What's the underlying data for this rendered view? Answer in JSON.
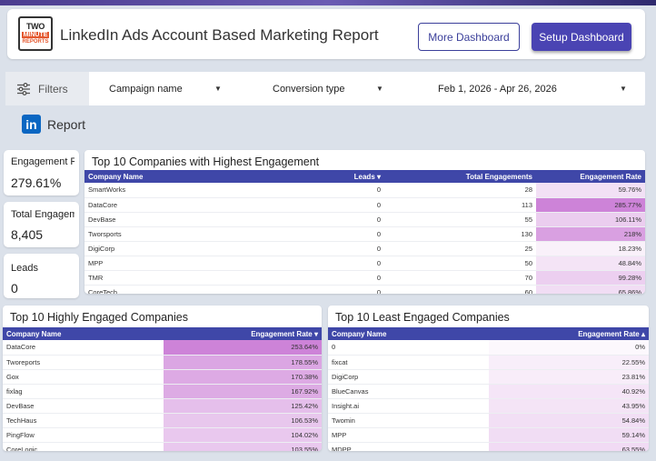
{
  "header": {
    "logo": {
      "line1": "TWO",
      "line2": "MINUTE",
      "line3": "REPORTS"
    },
    "title": "LinkedIn Ads Account Based Marketing Report",
    "more_dashboard": "More Dashboard",
    "setup_dashboard": "Setup Dashboard"
  },
  "filters": {
    "label": "Filters",
    "campaign": "Campaign name",
    "conversion": "Conversion type",
    "date_range": "Feb 1, 2026 - Apr 26, 2026"
  },
  "section": {
    "icon_text": "in",
    "label": "Report"
  },
  "kpis": [
    {
      "label": "Engagement Rate",
      "value": "279.61%"
    },
    {
      "label": "Total Engagements",
      "value": "8,405"
    },
    {
      "label": "Leads",
      "value": "0"
    }
  ],
  "top_engagement": {
    "title": "Top 10 Companies with Highest Engagement",
    "columns": [
      "Company Name",
      "Leads ▾",
      "Total Engagements",
      "Engagement Rate"
    ],
    "rows": [
      {
        "company": "SmartWorks",
        "leads": "0",
        "engagements": "28",
        "rate": "59.76%",
        "rate_value": 59.76
      },
      {
        "company": "DataCore",
        "leads": "0",
        "engagements": "113",
        "rate": "285.77%",
        "rate_value": 285.77
      },
      {
        "company": "DevBase",
        "leads": "0",
        "engagements": "55",
        "rate": "106.11%",
        "rate_value": 106.11
      },
      {
        "company": "Tworsports",
        "leads": "0",
        "engagements": "130",
        "rate": "218%",
        "rate_value": 218
      },
      {
        "company": "DigiCorp",
        "leads": "0",
        "engagements": "25",
        "rate": "18.23%",
        "rate_value": 18.23
      },
      {
        "company": "MPP",
        "leads": "0",
        "engagements": "50",
        "rate": "48.84%",
        "rate_value": 48.84
      },
      {
        "company": "TMR",
        "leads": "0",
        "engagements": "70",
        "rate": "99.28%",
        "rate_value": 99.28
      },
      {
        "company": "CoreTech",
        "leads": "0",
        "engagements": "60",
        "rate": "65.86%",
        "rate_value": 65.86
      }
    ]
  },
  "highly_engaged": {
    "title": "Top 10 Highly Engaged Companies",
    "columns": [
      "Company Name",
      "Engagement Rate ▾"
    ],
    "rows": [
      {
        "company": "DataCore",
        "rate": "253.64%",
        "rate_value": 253.64
      },
      {
        "company": "Tworeports",
        "rate": "178.55%",
        "rate_value": 178.55
      },
      {
        "company": "Gox",
        "rate": "170.38%",
        "rate_value": 170.38
      },
      {
        "company": "fixlag",
        "rate": "167.92%",
        "rate_value": 167.92
      },
      {
        "company": "DevBase",
        "rate": "125.42%",
        "rate_value": 125.42
      },
      {
        "company": "TechHaus",
        "rate": "106.53%",
        "rate_value": 106.53
      },
      {
        "company": "PingFlow",
        "rate": "104.02%",
        "rate_value": 104.02
      },
      {
        "company": "CoreLogic",
        "rate": "103.55%",
        "rate_value": 103.55
      }
    ]
  },
  "least_engaged": {
    "title": "Top 10 Least Engaged Companies",
    "columns": [
      "Company Name",
      "Engagement Rate ▴"
    ],
    "rows": [
      {
        "company": "0",
        "rate": "0%",
        "rate_value": 0
      },
      {
        "company": "fixcat",
        "rate": "22.55%",
        "rate_value": 22.55
      },
      {
        "company": "DigiCorp",
        "rate": "23.81%",
        "rate_value": 23.81
      },
      {
        "company": "BlueCanvas",
        "rate": "40.92%",
        "rate_value": 40.92
      },
      {
        "company": "Insight.ai",
        "rate": "43.95%",
        "rate_value": 43.95
      },
      {
        "company": "Twomin",
        "rate": "54.84%",
        "rate_value": 54.84
      },
      {
        "company": "MPP",
        "rate": "59.14%",
        "rate_value": 59.14
      },
      {
        "company": "MDPP",
        "rate": "63.55%",
        "rate_value": 63.55
      }
    ]
  },
  "colors": {
    "accent": "#3f47a8",
    "heat": "#b84fc7",
    "button": "#4a44b3",
    "linkedin": "#0a66c2"
  }
}
